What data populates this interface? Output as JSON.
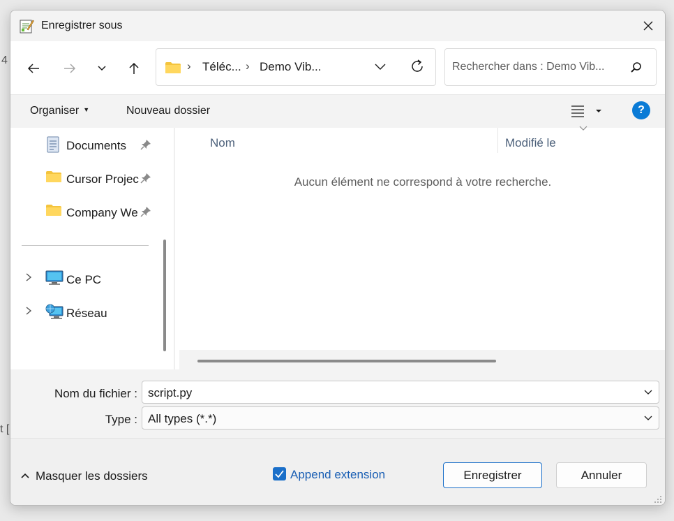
{
  "background": {
    "fragment_top": "4",
    "fragment_bottom": "t ["
  },
  "window": {
    "title": "Enregistrer sous",
    "app_icon": "notepad-plus-icon",
    "close_icon": "close-icon"
  },
  "nav": {
    "back_icon": "back-arrow-icon",
    "forward_icon": "forward-arrow-icon",
    "recent_icon": "chevron-down-icon",
    "up_icon": "up-arrow-icon",
    "breadcrumb": [
      "Téléc...",
      "Demo Vib..."
    ],
    "refresh_icon": "refresh-icon",
    "search_placeholder": "Rechercher dans : Demo Vib...",
    "search_icon": "search-icon"
  },
  "toolbar": {
    "organize": "Organiser",
    "new_folder": "Nouveau dossier",
    "view_icon": "view-list-icon",
    "help": "?"
  },
  "sidebar": {
    "pinned": [
      {
        "label": "Documents",
        "icon": "document-icon"
      },
      {
        "label": "Cursor Projec",
        "icon": "folder-icon"
      },
      {
        "label": "Company We",
        "icon": "folder-icon"
      }
    ],
    "locations": [
      {
        "label": "Ce PC",
        "icon": "computer-icon"
      },
      {
        "label": "Réseau",
        "icon": "network-icon"
      }
    ]
  },
  "filelist": {
    "columns": [
      "Nom",
      "Modifié le"
    ],
    "empty_message": "Aucun élément ne correspond à votre recherche."
  },
  "form": {
    "filename_label": "Nom du fichier :",
    "filename_value": "script.py",
    "type_label": "Type :",
    "type_value": "All types (*.*)"
  },
  "footer": {
    "hide_folders": "Masquer les dossiers",
    "append_extension": "Append extension",
    "append_checked": true,
    "save": "Enregistrer",
    "cancel": "Annuler"
  },
  "colors": {
    "accent": "#1a6fc9",
    "help_bg": "#0a7bd6",
    "column_header": "#4c607a"
  }
}
